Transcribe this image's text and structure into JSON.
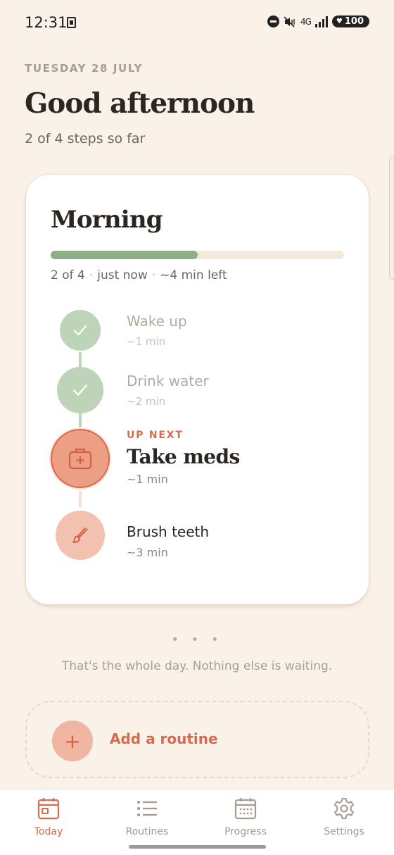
{
  "status_bar": {
    "time": "12:31",
    "network": "4G",
    "battery": "100"
  },
  "header": {
    "date": "TUESDAY 28 JULY",
    "greeting": "Good afternoon",
    "steps_summary": "2 of 4 steps so far"
  },
  "routine_card": {
    "title": "Morning",
    "progress_fraction": 0.5,
    "progress_count": "2 of 4",
    "last_updated": "just now",
    "time_left": "~4 min left",
    "steps": [
      {
        "name": "Wake up",
        "duration": "~1 min",
        "status": "done",
        "icon": "check-icon"
      },
      {
        "name": "Drink water",
        "duration": "~2 min",
        "status": "done",
        "icon": "check-icon"
      },
      {
        "tag": "UP NEXT",
        "name": "Take meds",
        "duration": "~1 min",
        "status": "next",
        "icon": "medical-kit-icon"
      },
      {
        "name": "Brush teeth",
        "duration": "~3 min",
        "status": "todo",
        "icon": "brush-icon"
      }
    ]
  },
  "footer_message": "That's the whole day. Nothing else is waiting.",
  "add_routine": {
    "label": "Add a routine",
    "icon": "plus-icon"
  },
  "bottom_nav": [
    {
      "label": "Today",
      "icon": "calendar-day-icon",
      "active": true
    },
    {
      "label": "Routines",
      "icon": "list-icon",
      "active": false
    },
    {
      "label": "Progress",
      "icon": "calendar-grid-icon",
      "active": false
    },
    {
      "label": "Settings",
      "icon": "gear-icon",
      "active": false
    }
  ],
  "colors": {
    "background": "#FAF1E8",
    "accent": "#D8694A",
    "done_green": "#8DAE86",
    "card": "#FFFFFF"
  }
}
